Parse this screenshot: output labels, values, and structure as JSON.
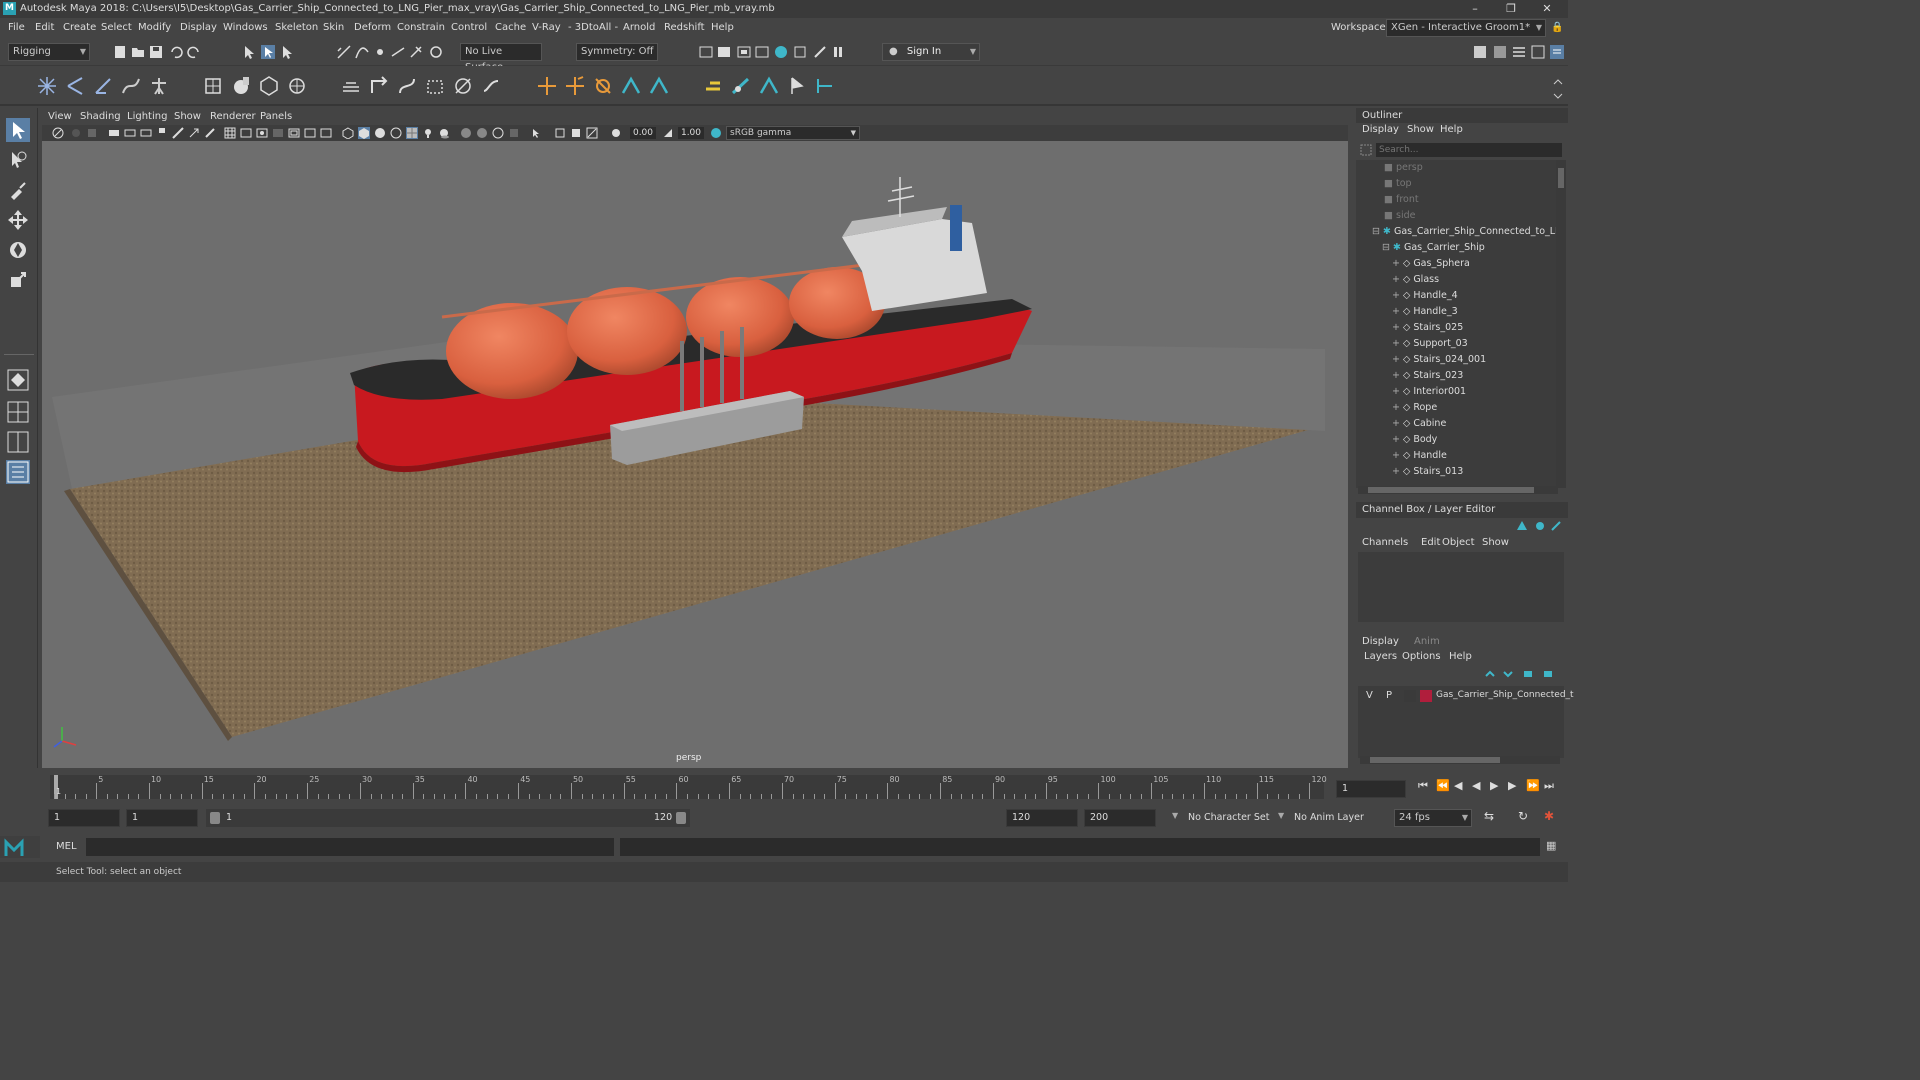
{
  "titlebar": {
    "title": "Autodesk Maya 2018: C:\\Users\\I5\\Desktop\\Gas_Carrier_Ship_Connected_to_LNG_Pier_max_vray\\Gas_Carrier_Ship_Connected_to_LNG_Pier_mb_vray.mb",
    "logo": "M"
  },
  "menubar": {
    "items": [
      "File",
      "Edit",
      "Create",
      "Select",
      "Modify",
      "Display",
      "Windows",
      "Skeleton",
      "Skin",
      "Deform",
      "Constrain",
      "Control",
      "Cache",
      "V-Ray",
      "- 3DtoAll -",
      "Arnold",
      "Redshift",
      "Help"
    ],
    "workspace_label": "Workspace :",
    "workspace_value": "XGen - Interactive Groom1*"
  },
  "shelf": {
    "mode": "Rigging",
    "live_surface": "No Live Surface",
    "symmetry": "Symmetry: Off",
    "sign_in": "Sign In"
  },
  "viewport": {
    "menus": [
      "View",
      "Shading",
      "Lighting",
      "Show",
      "Renderer",
      "Panels"
    ],
    "exposure": "0.00",
    "gamma": "1.00",
    "color_space": "sRGB gamma",
    "camera_label": "persp"
  },
  "outliner": {
    "title": "Outliner",
    "menus": [
      "Display",
      "Show",
      "Help"
    ],
    "search_placeholder": "Search...",
    "cameras": [
      "persp",
      "top",
      "front",
      "side"
    ],
    "root": "Gas_Carrier_Ship_Connected_to_LNG_",
    "group": "Gas_Carrier_Ship",
    "children": [
      "Gas_Sphera",
      "Glass",
      "Handle_4",
      "Handle_3",
      "Stairs_025",
      "Support_03",
      "Stairs_024_001",
      "Stairs_023",
      "Interior001",
      "Rope",
      "Cabine",
      "Body",
      "Handle",
      "Stairs_013"
    ]
  },
  "channelbox": {
    "title": "Channel Box / Layer Editor",
    "menus": [
      "Channels",
      "Edit",
      "Object",
      "Show"
    ]
  },
  "layereditor": {
    "tabs": [
      "Display",
      "Anim"
    ],
    "menus": [
      "Layers",
      "Options",
      "Help"
    ],
    "layer": {
      "v": "V",
      "p": "P",
      "name": "Gas_Carrier_Ship_Connected_t",
      "color": "#b01e3c"
    }
  },
  "timeline": {
    "ticks": [
      "5",
      "10",
      "15",
      "20",
      "25",
      "30",
      "35",
      "40",
      "45",
      "50",
      "55",
      "60",
      "65",
      "70",
      "75",
      "80",
      "85",
      "90",
      "95",
      "100",
      "105",
      "110",
      "115",
      "120"
    ],
    "start_marker": "1",
    "current_frame": "1"
  },
  "range": {
    "start": "1",
    "anim_start": "1",
    "slider_start": "1",
    "slider_end": "120",
    "end": "120",
    "anim_end": "200",
    "character_set": "No Character Set",
    "anim_layer": "No Anim Layer",
    "fps": "24 fps"
  },
  "command": {
    "label": "MEL"
  },
  "status": {
    "text": "Select Tool: select an object"
  }
}
